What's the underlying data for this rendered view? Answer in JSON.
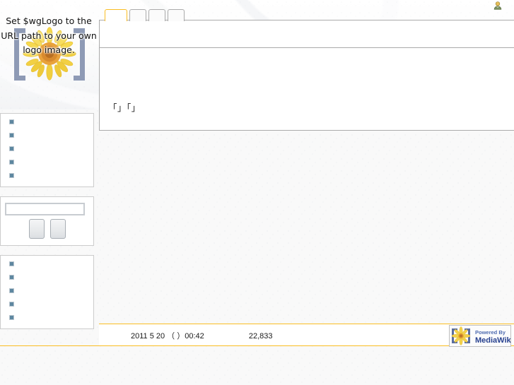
{
  "site": {
    "skin": "monobook",
    "logo_alt_text": "Set $wgLogo to the URL path to your own logo image.",
    "logo_icon": "sunflower-logo-placeholder-icon"
  },
  "personal_tools": {
    "icon": "user-avatar-icon",
    "label": ""
  },
  "tabs": [
    {
      "label": "",
      "name": "tab-article",
      "selected": true,
      "width": "w1"
    },
    {
      "label": "",
      "name": "tab-discussion",
      "selected": false,
      "width": "w2"
    },
    {
      "label": "",
      "name": "tab-edit",
      "selected": false,
      "width": "w2"
    },
    {
      "label": "",
      "name": "tab-history",
      "selected": false,
      "width": "w2"
    }
  ],
  "content": {
    "heading": "",
    "paragraphs": [
      "",
      ""
    ],
    "quoted_text": "「」「」"
  },
  "sidebar": {
    "navigation": {
      "heading": "",
      "items": [
        {
          "label": "",
          "name": "sidebar-item-main-page"
        },
        {
          "label": "",
          "name": "sidebar-item-community-portal"
        },
        {
          "label": "",
          "name": "sidebar-item-recent-changes"
        },
        {
          "label": "",
          "name": "sidebar-item-random-page"
        },
        {
          "label": "",
          "name": "sidebar-item-help"
        }
      ]
    },
    "search": {
      "heading": "",
      "input_value": "",
      "input_placeholder": "",
      "go_button_label": "",
      "search_button_label": ""
    },
    "toolbox": {
      "heading": "",
      "items": [
        {
          "label": "",
          "name": "toolbox-item-what-links-here"
        },
        {
          "label": "",
          "name": "toolbox-item-related-changes"
        },
        {
          "label": "",
          "name": "toolbox-item-special-pages"
        },
        {
          "label": "",
          "name": "toolbox-item-printable-version"
        },
        {
          "label": "",
          "name": "toolbox-item-permanent-link"
        }
      ]
    }
  },
  "footer": {
    "last_modified": "2011 5 20 （ ）00:42",
    "view_count": "22,833",
    "powered_by": {
      "line1": "Powered By",
      "line2": "MediaWiki",
      "icon": "mediawiki-sunflower-badge-icon"
    }
  },
  "colors": {
    "accent_orange": "#fabd23",
    "link_blue": "#0645ad",
    "bullet_blue": "#5e87a0",
    "border_gray": "#aaaaaa",
    "page_bg": "#f9f9f9",
    "content_bg": "#ffffff"
  }
}
